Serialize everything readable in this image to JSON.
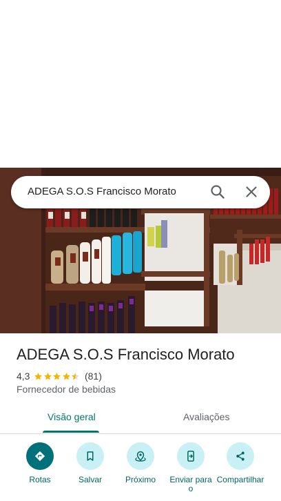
{
  "search": {
    "query": "ADEGA S.O.S Francisco Morato"
  },
  "place": {
    "name": "ADEGA S.O.S Francisco Morato",
    "rating": "4,3",
    "review_count": "(81)",
    "category": "Fornecedor de bebidas",
    "stars_value": 4.3
  },
  "tabs": [
    {
      "label": "Visão geral",
      "active": true
    },
    {
      "label": "Avaliações",
      "active": false
    }
  ],
  "actions": [
    {
      "label": "Rotas",
      "icon": "directions-icon"
    },
    {
      "label": "Salvar",
      "icon": "bookmark-icon"
    },
    {
      "label": "Próximo",
      "icon": "nearby-icon"
    },
    {
      "label": "Enviar para o",
      "icon": "send-to-phone-icon"
    },
    {
      "label": "Compartilhar",
      "icon": "share-icon"
    }
  ],
  "colors": {
    "accent": "#00796b",
    "action_bg": "#c9f1f5",
    "primary_action": "#00707a",
    "star": "#f4b400"
  }
}
